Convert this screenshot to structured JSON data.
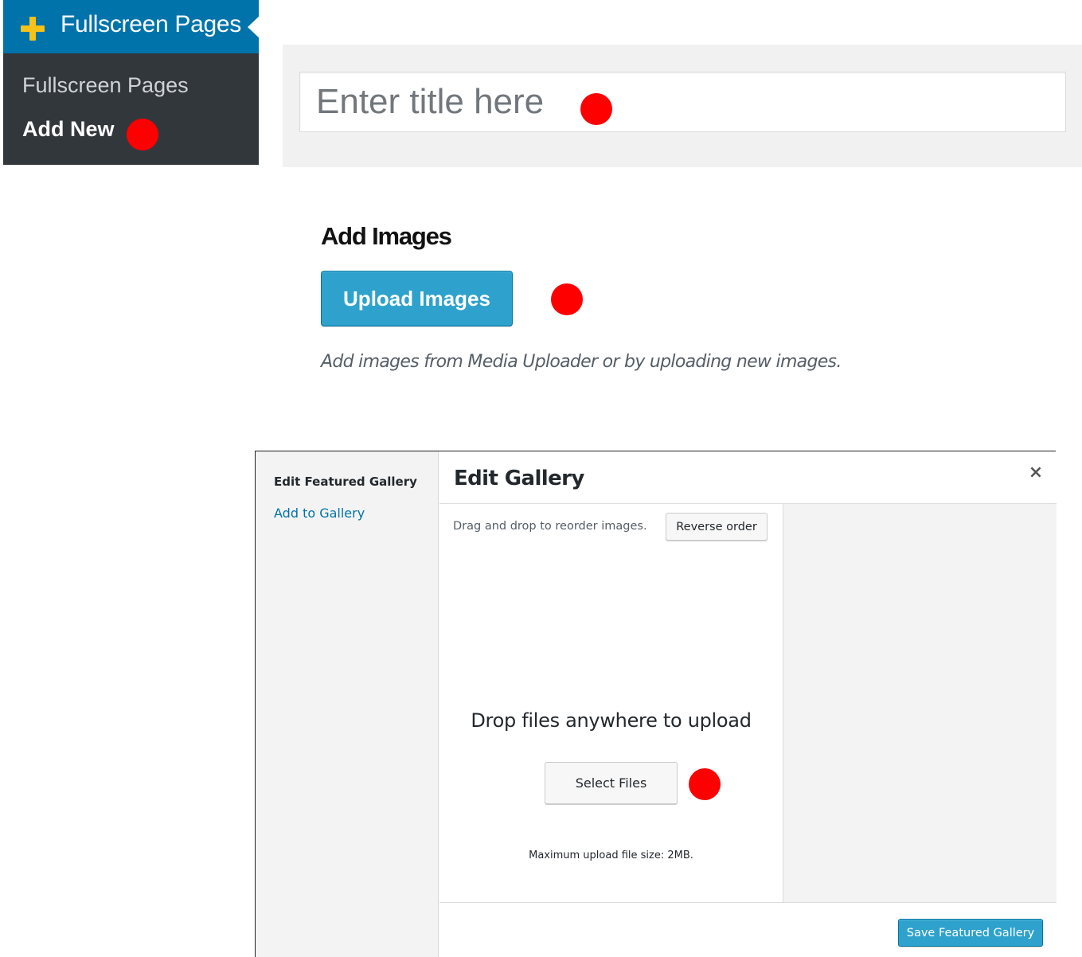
{
  "admin_menu": {
    "header_label": "Fullscreen Pages",
    "header_icon": "plus-icon",
    "header_color": "#0073aa",
    "items": [
      {
        "label": "Fullscreen Pages"
      },
      {
        "label": "Add New"
      }
    ]
  },
  "title_field": {
    "placeholder": "Enter title here",
    "value": ""
  },
  "images_section": {
    "heading": "Add Images",
    "upload_button": "Upload Images",
    "help_text": "Add images from Media Uploader or by uploading new images."
  },
  "media_modal": {
    "menu": {
      "active_item": "Edit Featured Gallery",
      "link_item": "Add to Gallery"
    },
    "title": "Edit Gallery",
    "close_icon": "close-icon",
    "drag_note": "Drag and drop to reorder images.",
    "reverse_button": "Reverse order",
    "drop_text": "Drop files anywhere to upload",
    "select_button": "Select Files",
    "max_size_note": "Maximum upload file size: 2MB.",
    "save_button": "Save Featured Gallery"
  },
  "colors": {
    "primary_button": "#2ea2cc",
    "link": "#0073aa",
    "marker": "#ff0000",
    "admin_sidebar": "#32373c"
  }
}
